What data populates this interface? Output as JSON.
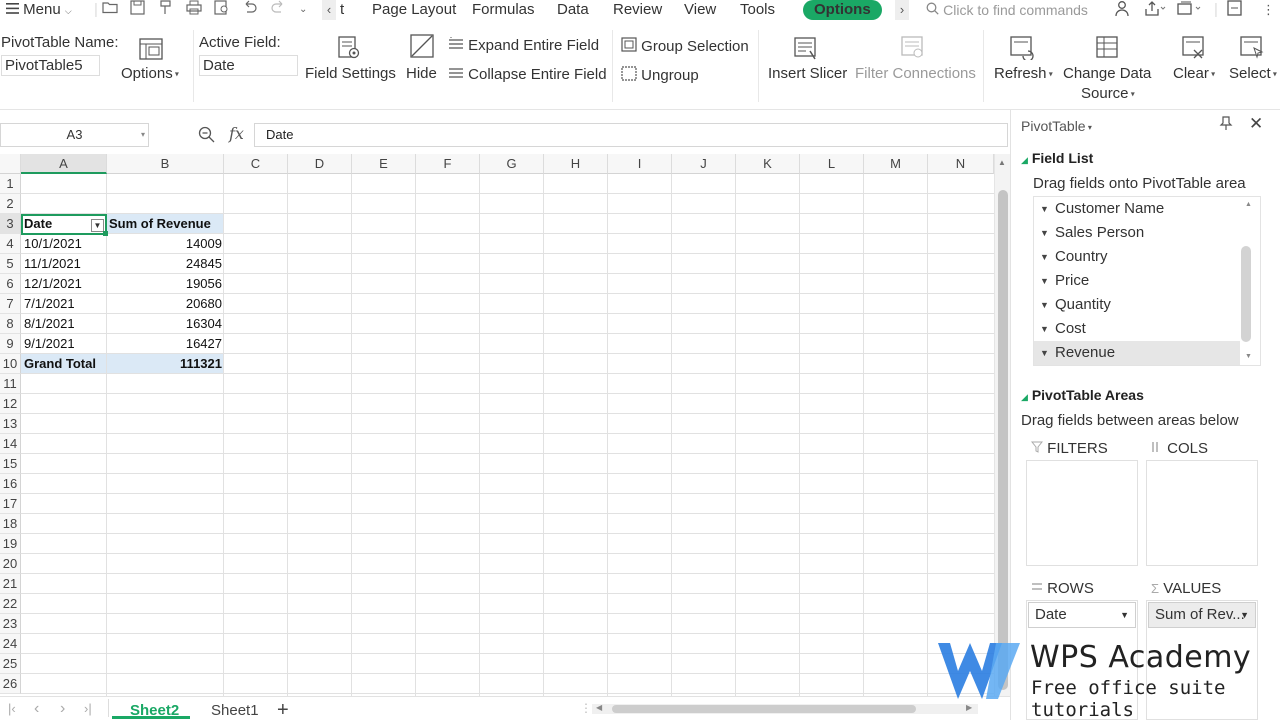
{
  "menubar": {
    "menu_label": "Menu",
    "truncated_tab": "t",
    "tabs": [
      "Page Layout",
      "Formulas",
      "Data",
      "Review",
      "View",
      "Tools"
    ],
    "active_tab": "Options",
    "search_placeholder": "Click to find commands"
  },
  "ribbon": {
    "pivot_name_label": "PivotTable Name:",
    "pivot_name_value": "PivotTable5",
    "options": "Options",
    "active_field_label": "Active Field:",
    "active_field_value": "Date",
    "field_settings": "Field Settings",
    "hide": "Hide",
    "expand_entire_field": "Expand Entire Field",
    "collapse_entire_field": "Collapse Entire Field",
    "group_selection": "Group Selection",
    "ungroup": "Ungroup",
    "insert_slicer": "Insert Slicer",
    "filter_connections": "Filter Connections",
    "refresh": "Refresh",
    "change_data_source_1": "Change Data",
    "change_data_source_2": "Source",
    "clear": "Clear",
    "select": "Select"
  },
  "formula_bar": {
    "name_box": "A3",
    "fx": "fx",
    "content": "Date"
  },
  "sheet": {
    "columns": [
      "A",
      "B",
      "C",
      "D",
      "E",
      "F",
      "G",
      "H",
      "I",
      "J",
      "K",
      "L",
      "M",
      "N"
    ],
    "rows": [
      "1",
      "2",
      "3",
      "4",
      "5",
      "6",
      "7",
      "8",
      "9",
      "10",
      "11",
      "12",
      "13",
      "14",
      "15",
      "16",
      "17",
      "18",
      "19",
      "20",
      "21",
      "22",
      "23",
      "24",
      "25",
      "26"
    ],
    "pivot": {
      "header": [
        "Date",
        "Sum of Revenue"
      ],
      "data": [
        [
          "10/1/2021",
          "14009"
        ],
        [
          "11/1/2021",
          "24845"
        ],
        [
          "12/1/2021",
          "19056"
        ],
        [
          "7/1/2021",
          "20680"
        ],
        [
          "8/1/2021",
          "16304"
        ],
        [
          "9/1/2021",
          "16427"
        ]
      ],
      "total": [
        "Grand Total",
        "111321"
      ]
    }
  },
  "sheet_tabs": {
    "active": "Sheet2",
    "other": "Sheet1",
    "add": "+"
  },
  "pane": {
    "title": "PivotTable",
    "field_list_title": "Field List",
    "field_list_hint": "Drag fields onto PivotTable area",
    "fields": [
      "Customer Name",
      "Sales Person",
      "Country",
      "Price",
      "Quantity",
      "Cost",
      "Revenue"
    ],
    "areas_title": "PivotTable Areas",
    "areas_hint": "Drag fields between areas below",
    "filters": "FILTERS",
    "cols": "COLS",
    "rows": "ROWS",
    "values": "VALUES",
    "rows_value": "Date",
    "values_value": "Sum of Rev..."
  },
  "watermark": {
    "title": "WPS Academy",
    "subtitle": "Free office suite tutorials"
  },
  "colors": {
    "accent_green": "#1aa865",
    "selection_border": "#1e9b5e",
    "pivot_header_fill": "#dbe9f6",
    "logo_blue": "#2a7de1"
  }
}
